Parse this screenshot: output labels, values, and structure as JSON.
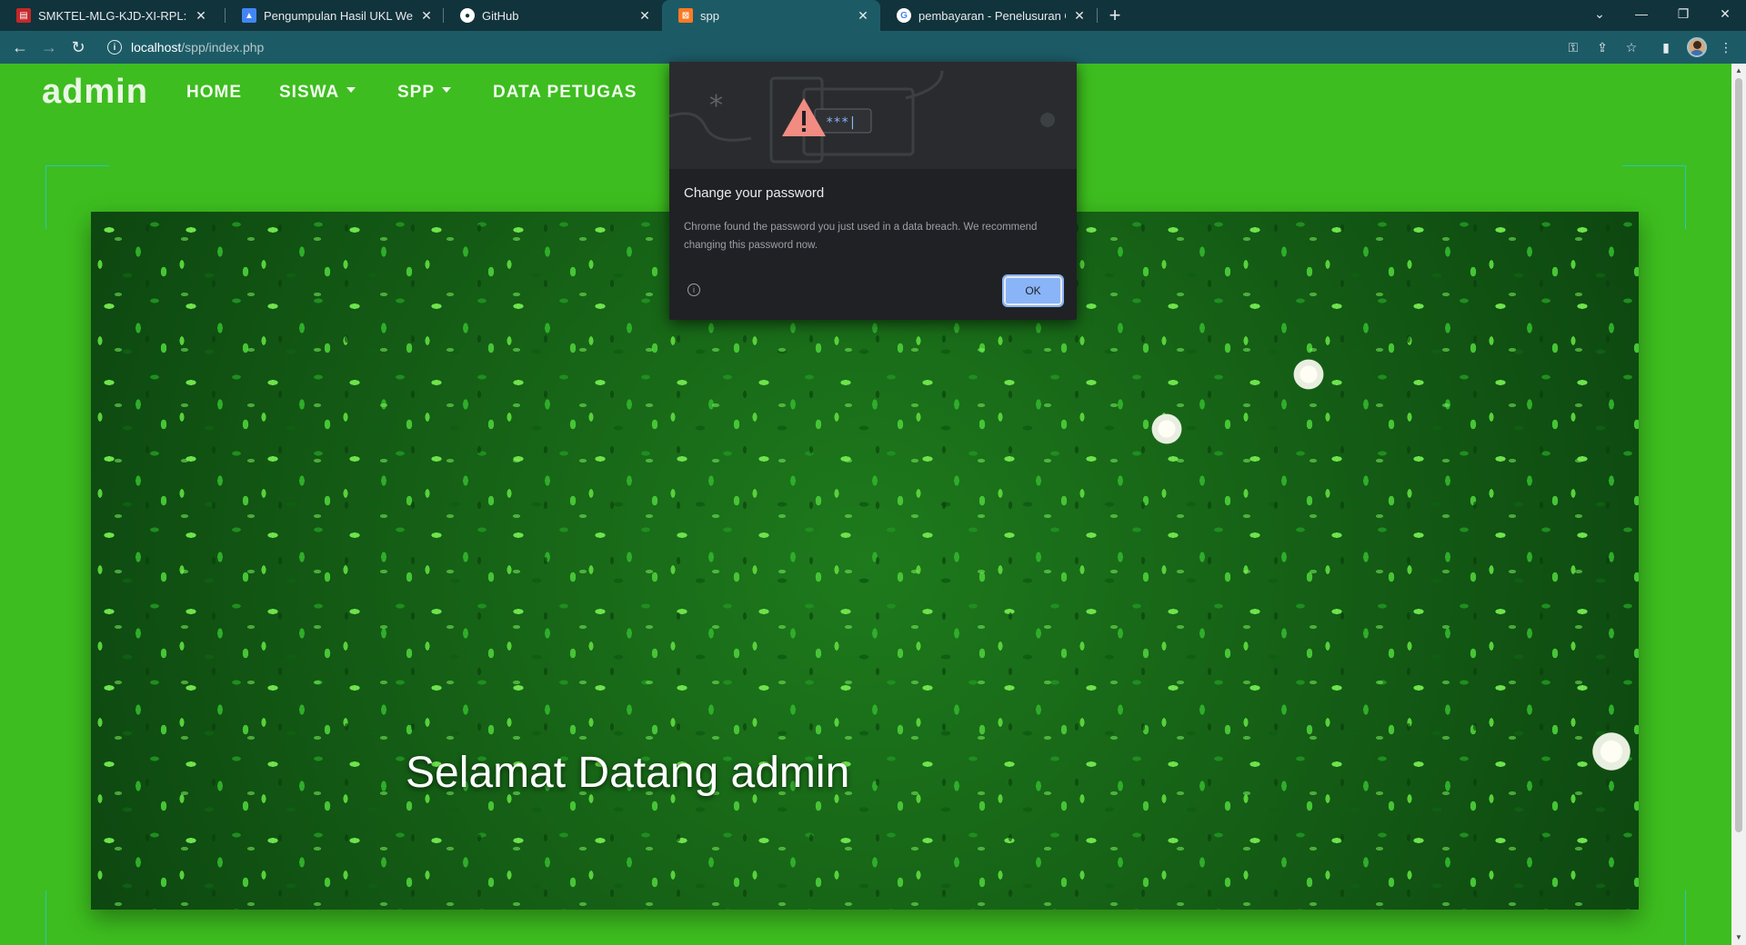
{
  "tabs": [
    {
      "title": "SMKTEL-MLG-KJD-XI-RPL: Modu",
      "favicon": "pdf-book-icon",
      "active": false
    },
    {
      "title": "Pengumpulan Hasil UKL Web",
      "favicon": "classroom-icon",
      "active": false
    },
    {
      "title": "GitHub",
      "favicon": "github-icon",
      "active": false
    },
    {
      "title": "spp",
      "favicon": "xampp-icon",
      "active": true
    },
    {
      "title": "pembayaran - Penelusuran Goog",
      "favicon": "google-icon",
      "active": false
    }
  ],
  "address_bar": {
    "host": "localhost",
    "path": "/spp/index.php"
  },
  "site": {
    "brand": "admin",
    "nav": {
      "home": "HOME",
      "siswa": "SISWA",
      "spp": "SPP",
      "petugas": "DATA PETUGAS"
    },
    "welcome": "Selamat Datang admin"
  },
  "dialog": {
    "title": "Change your password",
    "body": "Chrome found the password you just used in a data breach. We recommend changing this password now.",
    "ok_label": "OK",
    "masked": "***|"
  },
  "colors": {
    "page_background": "#3dbd1f",
    "tab_strip": "#11333c",
    "toolbar": "#1c5b66",
    "dialog_background": "#202124",
    "ok_button": "#8ab4f8",
    "frame_line": "#27c7c3"
  }
}
